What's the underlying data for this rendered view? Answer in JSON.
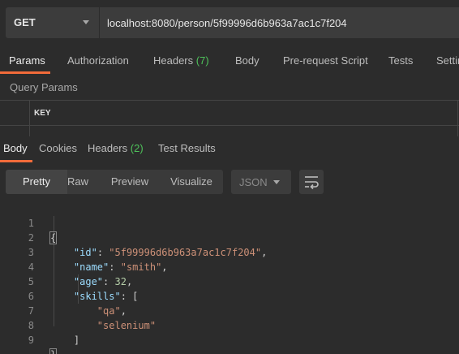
{
  "request": {
    "method": "GET",
    "url": "localhost:8080/person/5f99996d6b963a7ac1c7f204"
  },
  "request_tabs": [
    {
      "label": "Params",
      "count": "",
      "active": true
    },
    {
      "label": "Authorization",
      "count": ""
    },
    {
      "label": "Headers",
      "count": "(7)"
    },
    {
      "label": "Body",
      "count": ""
    },
    {
      "label": "Pre-request Script",
      "count": ""
    },
    {
      "label": "Tests",
      "count": ""
    },
    {
      "label": "Settings",
      "count": ""
    }
  ],
  "params": {
    "section_title": "Query Params",
    "column_key": "KEY"
  },
  "response_tabs": [
    {
      "label": "Body",
      "count": "",
      "active": true
    },
    {
      "label": "Cookies",
      "count": ""
    },
    {
      "label": "Headers",
      "count": "(2)"
    },
    {
      "label": "Test Results",
      "count": ""
    }
  ],
  "view_modes": [
    "Pretty",
    "Raw",
    "Preview",
    "Visualize"
  ],
  "view_active": "Pretty",
  "format": "JSON",
  "icons": {
    "format_caret": "chevron-down-icon",
    "wrap": "wrap-lines-icon"
  },
  "colors": {
    "accent": "#f26b3a",
    "count_green": "#4ec25a",
    "json_key": "#9cdcfe",
    "json_string": "#ce9178",
    "json_number": "#b5cea8"
  },
  "response_body": {
    "line_numbers": [
      "1",
      "2",
      "3",
      "4",
      "5",
      "6",
      "7",
      "8",
      "9"
    ],
    "open_brace": "{",
    "close_brace": "}",
    "fields": {
      "id_key": "\"id\"",
      "id_value": "\"5f99996d6b963a7ac1c7f204\"",
      "name_key": "\"name\"",
      "name_value": "\"smith\"",
      "age_key": "\"age\"",
      "age_value": "32",
      "skills_key": "\"skills\"",
      "skills_open": "[",
      "skills_close": "]",
      "skill_0": "\"qa\"",
      "skill_1": "\"selenium\""
    }
  }
}
